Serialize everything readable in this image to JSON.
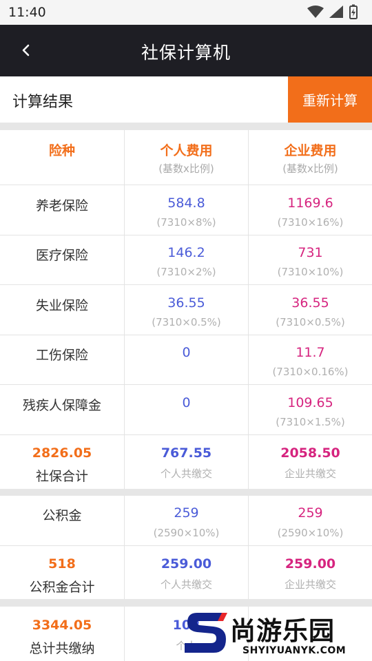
{
  "status": {
    "time": "11:40"
  },
  "nav": {
    "title": "社保计算机"
  },
  "result": {
    "label": "计算结果",
    "recalc": "重新计算"
  },
  "header": {
    "col1": "险种",
    "col2": "个人费用",
    "col2_sub": "(基数x比例)",
    "col3": "企业费用",
    "col3_sub": "(基数x比例)"
  },
  "rows": [
    {
      "name": "养老保险",
      "personal": "584.8",
      "personal_formula": "(7310×8%)",
      "company": "1169.6",
      "company_formula": "(7310×16%)"
    },
    {
      "name": "医疗保险",
      "personal": "146.2",
      "personal_formula": "(7310×2%)",
      "company": "731",
      "company_formula": "(7310×10%)"
    },
    {
      "name": "失业保险",
      "personal": "36.55",
      "personal_formula": "(7310×0.5%)",
      "company": "36.55",
      "company_formula": "(7310×0.5%)"
    },
    {
      "name": "工伤保险",
      "personal": "0",
      "personal_formula": "",
      "company": "11.7",
      "company_formula": "(7310×0.16%)"
    },
    {
      "name": "残疾人保障金",
      "personal": "0",
      "personal_formula": "",
      "company": "109.65",
      "company_formula": "(7310×1.5%)"
    }
  ],
  "social_total": {
    "amount": "2826.05",
    "label": "社保合计",
    "personal": "767.55",
    "personal_label": "个人共缴交",
    "company": "2058.50",
    "company_label": "企业共缴交"
  },
  "fund": {
    "name": "公积金",
    "personal": "259",
    "personal_formula": "(2590×10%)",
    "company": "259",
    "company_formula": "(2590×10%)"
  },
  "fund_total": {
    "amount": "518",
    "label": "公积金合计",
    "personal": "259.00",
    "personal_label": "个人共缴交",
    "company": "259.00",
    "company_label": "企业共缴交"
  },
  "grand_total": {
    "amount": "3344.05",
    "label": "总计共缴纳",
    "personal_partial": "102",
    "personal_label_partial": "个人"
  },
  "watermark": {
    "text": "尚游乐园",
    "url": "SHYIYUANYK.COM"
  },
  "colors": {
    "accent": "#f26e1a",
    "personal": "#4a5bd8",
    "company": "#d6247f",
    "navbar": "#1e1e24"
  }
}
